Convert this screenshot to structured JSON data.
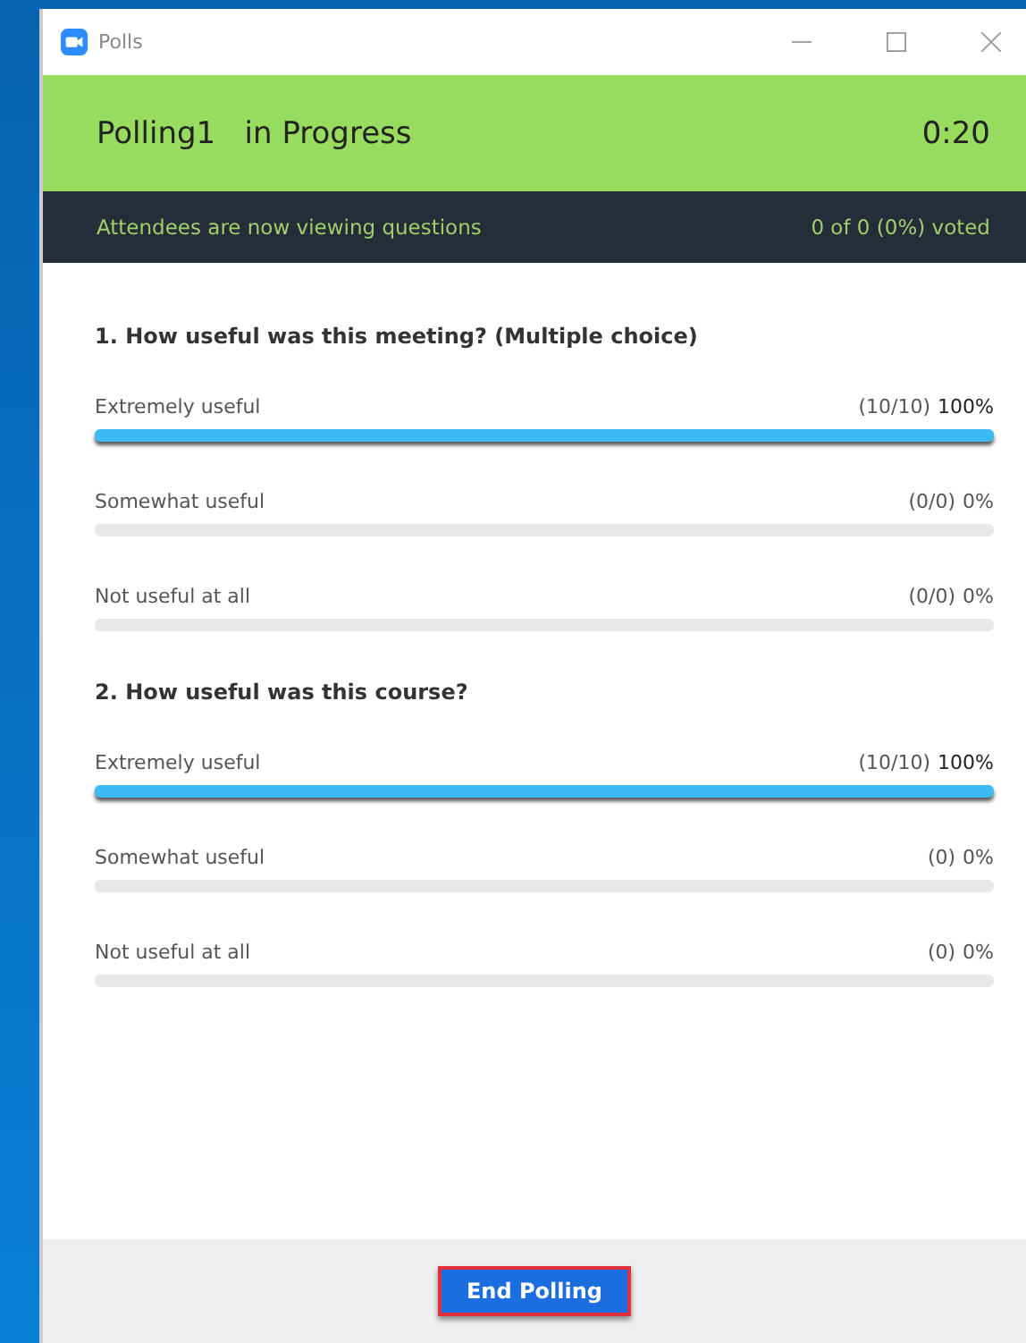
{
  "window": {
    "title": "Polls"
  },
  "header": {
    "title": "Polling1   in Progress",
    "timer": "0:20"
  },
  "status": {
    "message": "Attendees are now viewing questions",
    "votes": "0 of 0 (0%) voted"
  },
  "questions": [
    {
      "title": "1. How useful was this meeting? (Multiple choice)",
      "answers": [
        {
          "label": "Extremely useful",
          "count": "(10/10)",
          "percent": "100%",
          "level": 1
        },
        {
          "label": "Somewhat useful",
          "count": "(0/0)",
          "percent": "0%",
          "level": 0
        },
        {
          "label": "Not useful at all",
          "count": "(0/0)",
          "percent": "0%",
          "level": 0
        }
      ]
    },
    {
      "title": "2. How useful was this course?",
      "answers": [
        {
          "label": "Extremely useful",
          "count": "(10/10)",
          "percent": "100%",
          "level": 1
        },
        {
          "label": "Somewhat useful",
          "count": "(0)",
          "percent": "0%",
          "level": 0
        },
        {
          "label": "Not useful at all",
          "count": "(0)",
          "percent": "0%",
          "level": 0
        }
      ]
    }
  ],
  "button": "End Polling"
}
